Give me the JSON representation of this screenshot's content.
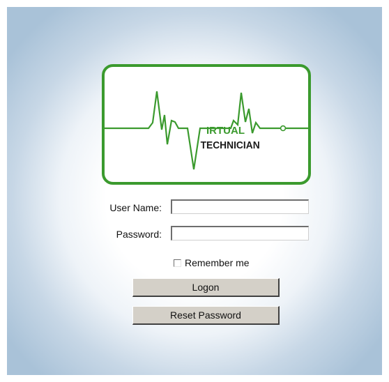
{
  "logo": {
    "text_line1": "IRTUAL",
    "text_line2": "TECHNICIAN",
    "color": "#3b9a2e"
  },
  "form": {
    "username_label": "User Name:",
    "username_value": "",
    "password_label": "Password:",
    "password_value": "",
    "remember_label": "Remember me",
    "remember_checked": false,
    "logon_label": "Logon",
    "reset_label": "Reset Password"
  }
}
